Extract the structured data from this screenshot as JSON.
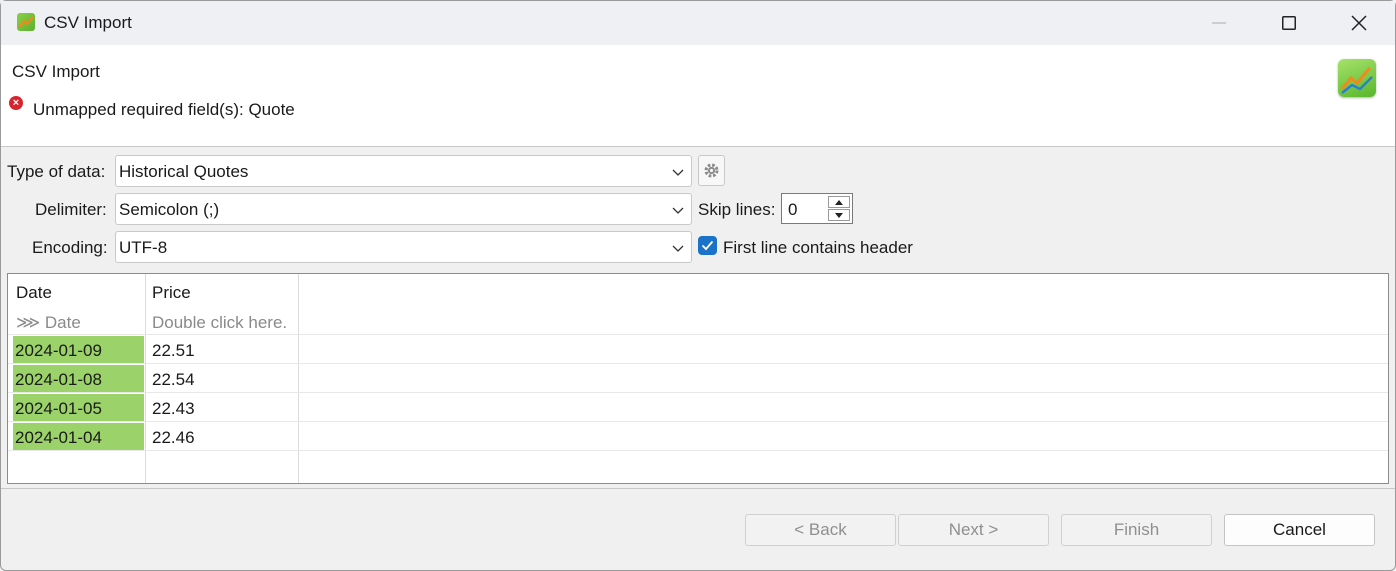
{
  "window": {
    "title": "CSV Import"
  },
  "header": {
    "title": "CSV Import",
    "error_message": "Unmapped required field(s): Quote"
  },
  "form": {
    "type_label": "Type of data:",
    "type_value": "Historical Quotes",
    "delimiter_label": "Delimiter:",
    "delimiter_value": "Semicolon (;)",
    "encoding_label": "Encoding:",
    "encoding_value": "UTF-8",
    "skip_lines_label": "Skip lines:",
    "skip_lines_value": "0",
    "header_checkbox_label": "First line contains header",
    "header_checkbox_checked": true
  },
  "table": {
    "columns": [
      "Date",
      "Price"
    ],
    "mappings": [
      "⋙ Date",
      "Double click here."
    ],
    "rows": [
      [
        "2024-01-09",
        "22.51"
      ],
      [
        "2024-01-08",
        "22.54"
      ],
      [
        "2024-01-05",
        "22.43"
      ],
      [
        "2024-01-04",
        "22.46"
      ]
    ]
  },
  "buttons": {
    "back": "< Back",
    "next": "Next >",
    "finish": "Finish",
    "cancel": "Cancel"
  },
  "colors": {
    "mapped_column": "#9bd36a",
    "error": "#d9232d",
    "checkbox": "#1a73c8"
  }
}
